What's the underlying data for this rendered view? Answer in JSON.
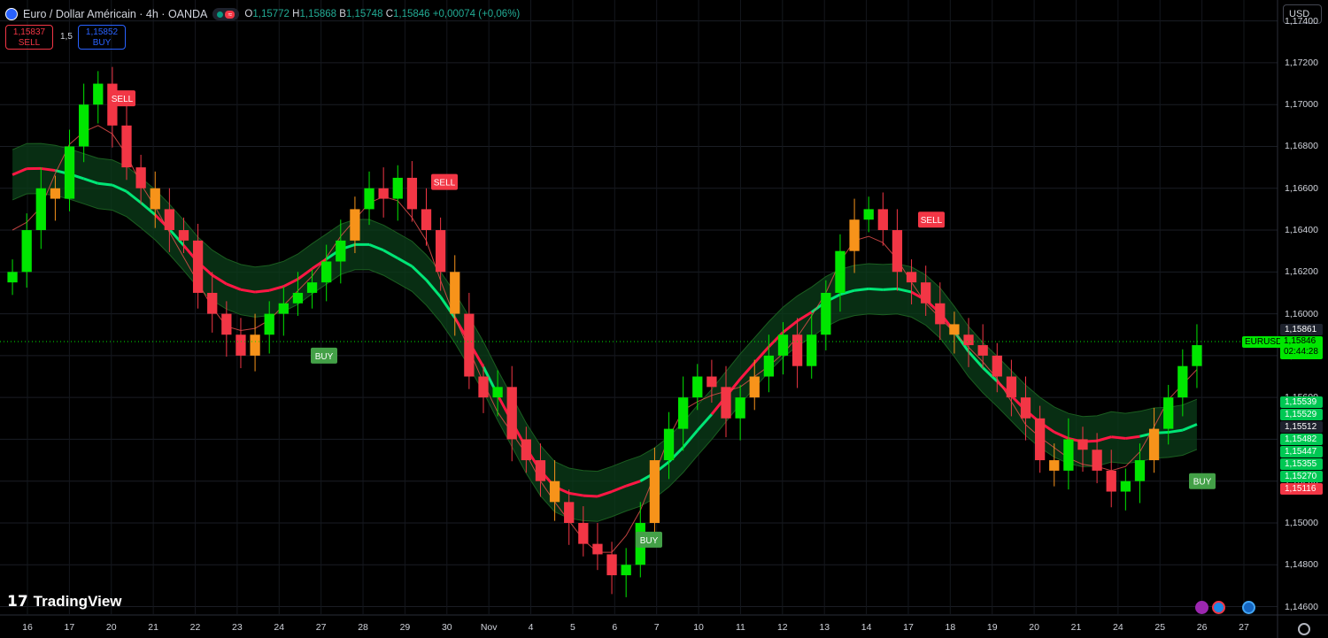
{
  "header": {
    "title": "Euro / Dollar Américain · 4h · OANDA",
    "ohlc": [
      {
        "k": "O",
        "v": "1,15772"
      },
      {
        "k": "H",
        "v": "1,15868"
      },
      {
        "k": "B",
        "v": "1,15748"
      },
      {
        "k": "C",
        "v": "1,15846"
      },
      {
        "k": "",
        "v": "+0,00074 (+0,06%)"
      }
    ],
    "sell_price": "1,15837",
    "sell_label": "SELL",
    "spread": "1,5",
    "buy_price": "1,15852",
    "buy_label": "BUY",
    "currency": "USD"
  },
  "branding": {
    "logo_text": "TradingView"
  },
  "price_scale": {
    "labels": [
      "1,17400",
      "1,17200",
      "1,17000",
      "1,16800",
      "1,16600",
      "1,16400",
      "1,16200",
      "1,16000",
      "1,15800",
      "1,15600",
      "1,15400",
      "1,15200",
      "1,15000",
      "1,14800",
      "1,14600"
    ],
    "tags": [
      {
        "value": "1,15861",
        "bg": "#1e222d",
        "fg": "#ffffff"
      },
      {
        "value": "1,15539",
        "bg": "#00c853",
        "fg": "#ffffff"
      },
      {
        "value": "1,15529",
        "bg": "#00c853",
        "fg": "#ffffff"
      },
      {
        "value": "1,15512",
        "bg": "#1e222d",
        "fg": "#ffffff"
      },
      {
        "value": "1,15482",
        "bg": "#00c853",
        "fg": "#ffffff"
      },
      {
        "value": "1,15447",
        "bg": "#00c853",
        "fg": "#ffffff"
      },
      {
        "value": "1,15355",
        "bg": "#00c853",
        "fg": "#ffffff"
      },
      {
        "value": "1,15270",
        "bg": "#00c853",
        "fg": "#ffffff"
      },
      {
        "value": "1,15116",
        "bg": "#f23645",
        "fg": "#ffffff"
      }
    ],
    "symbol_tag": "EURUSD",
    "last_price": "1,15846",
    "countdown": "02:44:28"
  },
  "time_axis": [
    "16",
    "17",
    "20",
    "21",
    "22",
    "23",
    "24",
    "27",
    "28",
    "29",
    "30",
    "Nov",
    "4",
    "5",
    "6",
    "7",
    "10",
    "11",
    "12",
    "13",
    "14",
    "17",
    "18",
    "19",
    "20",
    "21",
    "24",
    "25",
    "26",
    "27"
  ],
  "colors": {
    "bull": "#00e600",
    "bear": "#f23645",
    "neutral": "#f7931a",
    "band_green": "#00e676",
    "band_red": "#ff1744"
  },
  "chart_data": {
    "type": "candlestick",
    "title": "Euro / Dollar Américain · 4h · OANDA",
    "ylim": [
      1.1456,
      1.175
    ],
    "close_path": [
      1.162,
      1.164,
      1.166,
      1.1655,
      1.168,
      1.17,
      1.171,
      1.169,
      1.167,
      1.166,
      1.165,
      1.164,
      1.1635,
      1.161,
      1.16,
      1.159,
      1.158,
      1.159,
      1.16,
      1.1605,
      1.161,
      1.1615,
      1.1625,
      1.1635,
      1.165,
      1.166,
      1.1655,
      1.1665,
      1.165,
      1.164,
      1.162,
      1.16,
      1.157,
      1.156,
      1.1565,
      1.154,
      1.153,
      1.152,
      1.151,
      1.15,
      1.149,
      1.1485,
      1.1475,
      1.148,
      1.15,
      1.153,
      1.1545,
      1.156,
      1.157,
      1.1565,
      1.155,
      1.156,
      1.157,
      1.158,
      1.159,
      1.1575,
      1.159,
      1.161,
      1.163,
      1.1645,
      1.165,
      1.164,
      1.162,
      1.1615,
      1.1605,
      1.1595,
      1.159,
      1.1585,
      1.158,
      1.157,
      1.156,
      1.155,
      1.153,
      1.1525,
      1.154,
      1.1535,
      1.1525,
      1.1515,
      1.152,
      1.153,
      1.1545,
      1.156,
      1.1575,
      1.1585
    ],
    "signals": [
      {
        "label": "SELL",
        "type": "sell",
        "price": 1.1703
      },
      {
        "label": "BUY",
        "type": "buy",
        "price": 1.158
      },
      {
        "label": "SELL",
        "type": "sell",
        "price": 1.1663
      },
      {
        "label": "BUY",
        "type": "buy",
        "price": 1.1492
      },
      {
        "label": "SELL",
        "type": "sell",
        "price": 1.1645
      },
      {
        "label": "BUY",
        "type": "buy",
        "price": 1.152
      }
    ]
  }
}
